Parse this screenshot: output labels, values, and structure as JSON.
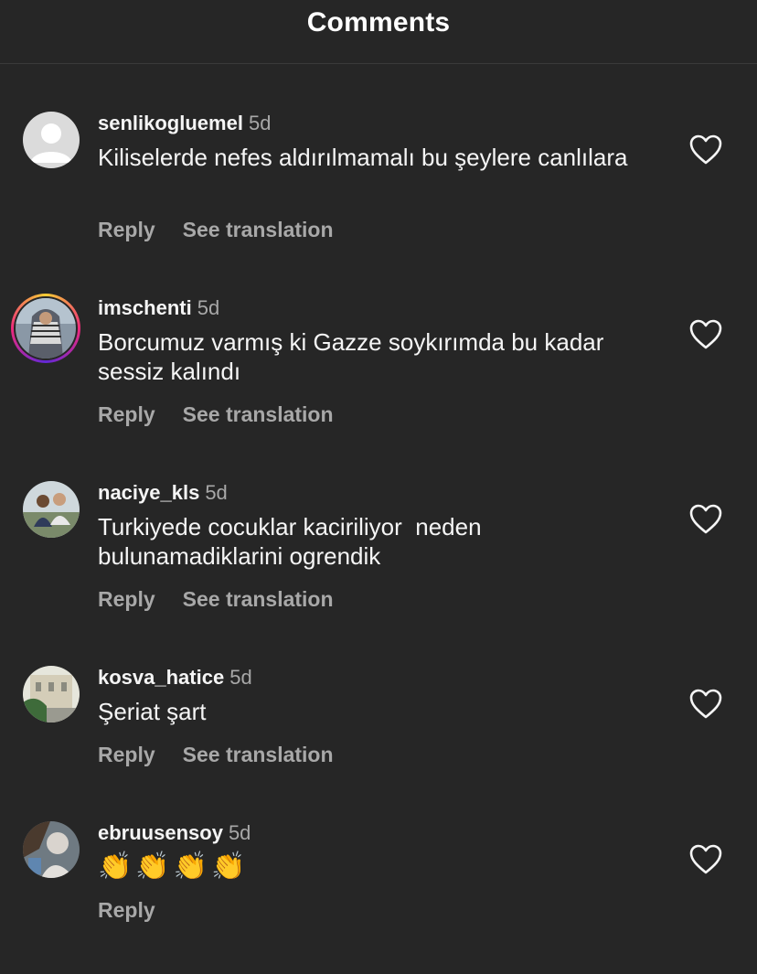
{
  "header": {
    "title": "Comments"
  },
  "comments": [
    {
      "username": "senlikogluemel",
      "time": "5d",
      "text": "Kiliselerde nefes aldırılmamalı bu şeylere canlılara",
      "reply_label": "Reply",
      "translate_label": "See translation",
      "avatar_icon": "default-avatar-icon"
    },
    {
      "username": "imschenti",
      "time": "5d",
      "text": "Borcumuz varmış ki Gazze soykırımda bu kadar sessiz kalındı",
      "reply_label": "Reply",
      "translate_label": "See translation",
      "avatar_icon": "story-ring-avatar"
    },
    {
      "username": "naciye_kls",
      "time": "5d",
      "text": "Turkiyede cocuklar kaciriliyor  neden bulunamadiklarini ogrendik",
      "reply_label": "Reply",
      "translate_label": "See translation",
      "avatar_icon": "photo-avatar"
    },
    {
      "username": "kosva_hatice",
      "time": "5d",
      "text": "Şeriat şart",
      "reply_label": "Reply",
      "translate_label": "See translation",
      "avatar_icon": "photo-avatar"
    },
    {
      "username": "ebruusensoy",
      "time": "5d",
      "text": "👏👏👏👏",
      "reply_label": "Reply",
      "avatar_icon": "photo-avatar"
    }
  ],
  "colors": {
    "background": "#262626",
    "primary_text": "#f5f5f5",
    "secondary_text": "#a8a8a8",
    "story_ring": [
      "#f9ce34",
      "#ee2a7b",
      "#6228d7"
    ]
  },
  "icons": {
    "like": "heart-outline-icon"
  }
}
